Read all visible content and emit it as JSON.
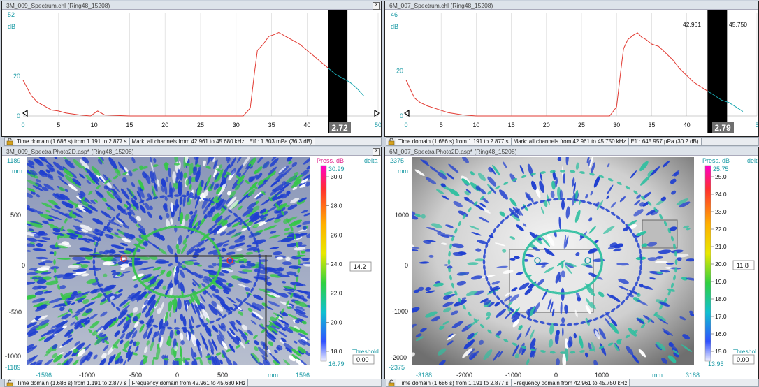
{
  "spectrum_left": {
    "title": "3M_009_Spectrum.chl (Ring48_15208)",
    "close": "X",
    "ytop": "52",
    "yunit": "dB",
    "yticks": [
      "20",
      "0"
    ],
    "xticks": [
      "0",
      "5",
      "10",
      "15",
      "20",
      "25",
      "30",
      "35",
      "40",
      "50"
    ],
    "badge": "2.72",
    "status": [
      "Time domain (1.686 s) from 1.191 to 2.877 s",
      "Mark: all channels from 42.961 to 45.680 kHz",
      "Eff.: 1.303 mPa (36.3 dB)"
    ]
  },
  "spectrum_right": {
    "title": "6M_007_Spectrum.chl (Ring48_15208)",
    "ytop": "46",
    "yunit": "dB",
    "yticks": [
      "20",
      "0"
    ],
    "xticks": [
      "0",
      "5",
      "10",
      "15",
      "20",
      "25",
      "30",
      "35",
      "40",
      "5"
    ],
    "mark_left": "42.961",
    "mark_right": "45.750",
    "badge": "2.79",
    "status": [
      "Time domain (1.686 s) from 1.191 to 2.877 s",
      "Mark: all channels from 42.961 to 45.750 kHz",
      "Eff.: 645.957 µPa (30.2 dB)"
    ]
  },
  "photo_left": {
    "title": "3M_009_SpectralPhoto2D.asp* (Ring48_15208)",
    "close": "X",
    "ytop": "1189",
    "yunit": "mm",
    "yticks": [
      "500",
      "0",
      "-500",
      "-1000"
    ],
    "ybottom": "-1189",
    "xticks": [
      "-1596",
      "-1000",
      "-500",
      "0",
      "500",
      "mm",
      "1596"
    ],
    "scale_title": "Press. dB",
    "delta": "delta",
    "scale_max": "30.99",
    "scale_ticks": [
      "30.0",
      "28.0",
      "26.0",
      "24.0",
      "22.0",
      "20.0",
      "18.0"
    ],
    "scale_min": "16.79",
    "cursor_value": "14.2",
    "threshold_label": "Threshold",
    "threshold_value": "0.00",
    "status": [
      "Time domain (1.686 s) from 1.191 to 2.877 s",
      "Frequency domain from 42.961 to 45.680 kHz"
    ]
  },
  "photo_right": {
    "title": "6M_007_SpectralPhoto2D.asp* (Ring48_15208)",
    "ytop": "2375",
    "yunit": "mm",
    "yticks": [
      "1000",
      "0",
      "-1000",
      "-2000"
    ],
    "ybottom": "-2375",
    "xticks": [
      "-3188",
      "-2000",
      "-1000",
      "0",
      "1000",
      "mm",
      "3188"
    ],
    "scale_title": "Press. dB",
    "delta": "delt",
    "scale_max": "25.75",
    "scale_ticks": [
      "25.0",
      "24.0",
      "23.0",
      "22.0",
      "21.0",
      "20.0",
      "19.0",
      "18.0",
      "17.0",
      "16.0",
      "15.0"
    ],
    "scale_min": "13.95",
    "cursor_value": "11.8",
    "threshold_label": "Threshol",
    "threshold_value": "0.00",
    "status": [
      "Time domain (1.686 s) from 1.191 to 2.877 s",
      "Frequency domain from 42.961 to 45.750 kHz"
    ]
  },
  "colors": {
    "spectrum_line": "#e23a32",
    "spectrum_tail": "#1aa7b0",
    "axis_text": "#1a9aa5",
    "heat_blue": "#1f3fd0",
    "heat_green": "#36c64a"
  },
  "chart_data": [
    {
      "type": "line",
      "title": "3M_009_Spectrum.chl (Ring48_15208)",
      "xlabel": "",
      "ylabel": "dB",
      "xlim": [
        0,
        50
      ],
      "ylim": [
        0,
        52
      ],
      "x": [
        0,
        0.6,
        1.2,
        2,
        3,
        4,
        5,
        6,
        8,
        9.5,
        10.5,
        11.5,
        15,
        20,
        25,
        31,
        32,
        32.6,
        33,
        33.8,
        34.6,
        35.4,
        36,
        37,
        38,
        39,
        40,
        41,
        42,
        43,
        44,
        45,
        46,
        47,
        48
      ],
      "y": [
        18,
        14,
        10,
        7,
        5,
        3,
        2.5,
        1.5,
        0.5,
        0,
        2.5,
        0.5,
        0,
        0,
        0,
        0,
        4,
        22,
        33,
        36,
        40,
        41,
        42,
        40,
        38,
        36,
        33,
        30,
        27,
        24,
        21,
        19,
        17,
        14,
        10
      ],
      "marked_range": [
        42.961,
        45.68
      ],
      "grid": true
    },
    {
      "type": "line",
      "title": "6M_007_Spectrum.chl (Ring48_15208)",
      "xlabel": "",
      "ylabel": "dB",
      "xlim": [
        0,
        50
      ],
      "ylim": [
        0,
        46
      ],
      "x": [
        0,
        0.6,
        1.2,
        2,
        3,
        4,
        5,
        6,
        8,
        10,
        15,
        20,
        25,
        29,
        30,
        30.6,
        31,
        31.6,
        32.4,
        33,
        33.6,
        34.2,
        35,
        36,
        37,
        38,
        39,
        40,
        41,
        42,
        43,
        44,
        45,
        46,
        47,
        48
      ],
      "y": [
        16,
        12,
        8,
        6,
        4.5,
        3.5,
        2.5,
        1.5,
        0.5,
        0,
        0,
        0,
        0,
        0,
        4,
        20,
        30,
        34,
        36,
        37,
        35,
        34,
        32,
        31,
        28,
        25,
        21,
        18,
        15,
        13,
        11,
        9,
        7,
        6,
        4,
        2
      ],
      "marked_range": [
        42.961,
        45.75
      ],
      "grid": true
    }
  ]
}
